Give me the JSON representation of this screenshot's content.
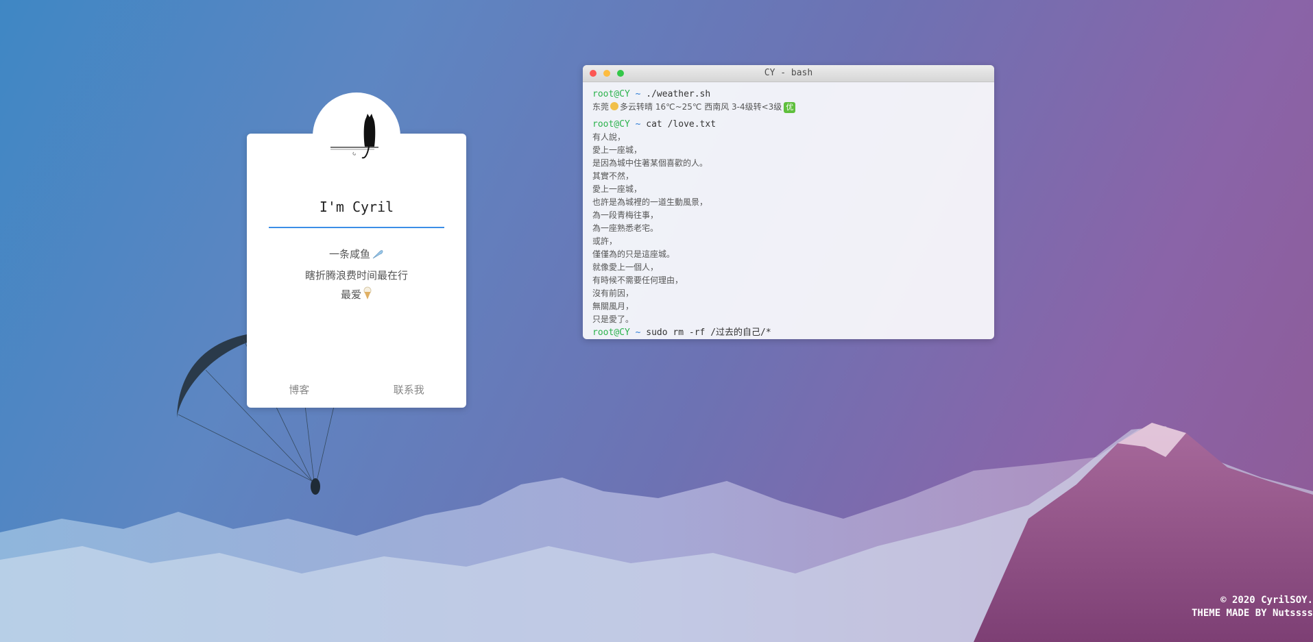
{
  "profile": {
    "name": "I'm Cyril",
    "bio": [
      {
        "text": "一条咸鱼",
        "icon": "fish-icon"
      },
      {
        "text": "瞎折腾浪费时间最在行",
        "icon": ""
      },
      {
        "text": "最爱",
        "icon": "ice-cream-icon"
      }
    ],
    "links": [
      "博客",
      "联系我"
    ]
  },
  "terminal": {
    "title": "CY - bash",
    "prompt_user": "root@CY",
    "prompt_sep": "~",
    "cmd1": "./weather.sh",
    "weather": {
      "city": "东莞",
      "text": "多云转晴 16℃~25℃ 西南风 3-4级转<3级",
      "aqi": "优"
    },
    "cmd2": "cat /love.txt",
    "love_lines": [
      "有人說，",
      "愛上一座城，",
      "是因為城中住著某個喜歡的人。",
      "其實不然，",
      "愛上一座城，",
      "也許是為城裡的一道生動風景，",
      "為一段青梅往事，",
      "為一座熟悉老宅。",
      "或許，",
      "僅僅為的只是這座城。",
      "就像愛上一個人，",
      "有時候不需要任何理由，",
      "沒有前因，",
      "無關風月，",
      "只是愛了。"
    ],
    "cmd3": "sudo rm -rf /过去的自己/*"
  },
  "footer": {
    "copyright": "© 2020 CyrilSOY.",
    "theme": "THEME MADE BY Nutssss"
  },
  "colors": {
    "accent": "#3a8ee6",
    "prompt": "#2bb24c"
  }
}
